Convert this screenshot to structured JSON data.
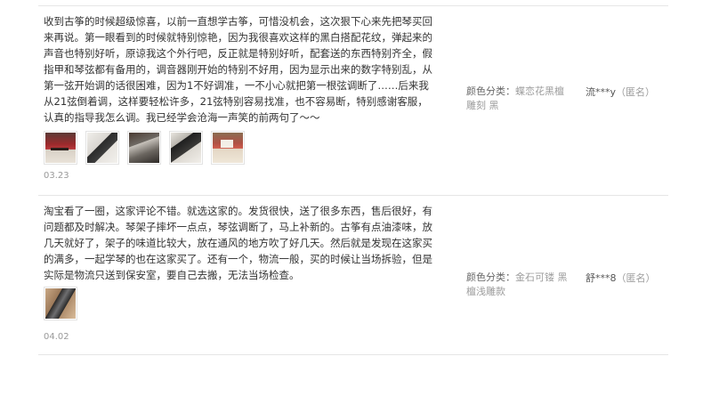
{
  "reviews": [
    {
      "content": "收到古筝的时候超级惊喜，以前一直想学古筝，可惜没机会，这次狠下心来先把琴买回来再说。第一眼看到的时候就特别惊艳，因为我很喜欢这样的黑白搭配花纹，弹起来的声音也特别好听，原谅我这个外行吧，反正就是特别好听，配套送的东西特别齐全，假指甲和琴弦都有备用的，调音器刚开始的特别不好用，因为显示出来的数字特别乱，从第一弦开始调的话很困难，因为1不好调准，一不小心就把第一根弦调断了……后来我从21弦倒着调，这样要轻松许多，21弦特别容易找准，也不容易断，特别感谢客服，认真的指导我怎么调。我已经学会沧海一声笑的前两句了～～",
      "photos": [
        "photo-1",
        "photo-2",
        "photo-3",
        "photo-4",
        "photo-5"
      ],
      "date": "03.23",
      "sku_key": "颜色分类：",
      "sku_value": "蝶恋花黑檀雕刻 黑",
      "user": "流***y",
      "anon": "（匿名）"
    },
    {
      "content": "淘宝看了一圈，这家评论不错。就选这家的。发货很快，送了很多东西，售后很好，有问题都及时解决。琴架子摔坏一点点，琴弦调断了，马上补新的。古筝有点油漆味，放几天就好了，架子的味道比较大，放在通风的地方吹了好几天。然后就是发现在这家买的满多，一起学琴的也在这家买了。还有一个，物流一般，买的时候让当场拆验，但是实际是物流只送到保安室，要自己去搬，无法当场检查。",
      "photos": [
        "photo-1"
      ],
      "date": "04.02",
      "sku_key": "颜色分类：",
      "sku_value": "金石可镂 黑檀浅雕款",
      "user": "舒***8",
      "anon": "（匿名）"
    }
  ]
}
